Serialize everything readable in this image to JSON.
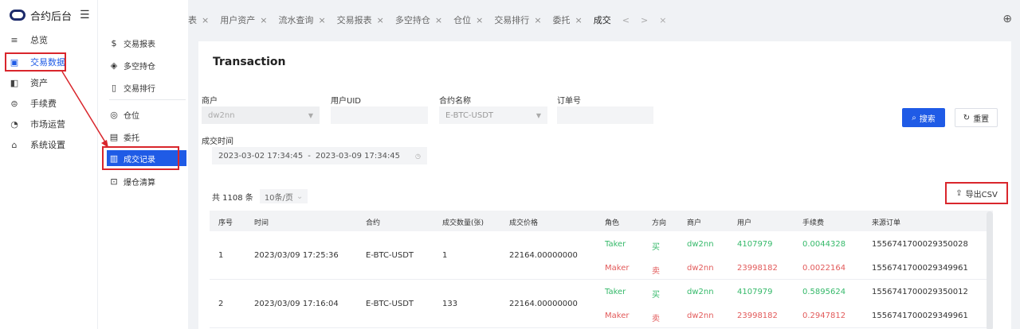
{
  "app": {
    "title": "合约后台"
  },
  "sidebar": {
    "items": [
      {
        "label": "总览",
        "icon": "menu-icon"
      },
      {
        "label": "交易数据",
        "icon": "chart-icon"
      },
      {
        "label": "资产",
        "icon": "wallet-icon"
      },
      {
        "label": "手续费",
        "icon": "fee-icon"
      },
      {
        "label": "市场运营",
        "icon": "operations-icon"
      },
      {
        "label": "系统设置",
        "icon": "settings-icon"
      }
    ]
  },
  "submenu": {
    "items": [
      {
        "label": "交易报表",
        "icon": "dollar-icon"
      },
      {
        "label": "多空持仓",
        "icon": "position-icon"
      },
      {
        "label": "交易排行",
        "icon": "ranking-icon"
      },
      {
        "label": "仓位",
        "icon": "circle-icon"
      },
      {
        "label": "委托",
        "icon": "order-icon"
      },
      {
        "label": "成交记录",
        "icon": "record-icon"
      },
      {
        "label": "爆仓清算",
        "icon": "liquidation-icon"
      }
    ]
  },
  "tabs": [
    {
      "label": "表"
    },
    {
      "label": "用户资产"
    },
    {
      "label": "流水查询"
    },
    {
      "label": "交易报表"
    },
    {
      "label": "多空持仓"
    },
    {
      "label": "仓位"
    },
    {
      "label": "交易排行"
    },
    {
      "label": "委托"
    }
  ],
  "active_tab": "成交",
  "page": {
    "title": "Transaction"
  },
  "filters": {
    "merchant_label": "商户",
    "merchant_value": "dw2nn",
    "uid_label": "用户UID",
    "contract_label": "合约名称",
    "contract_value": "E-BTC-USDT",
    "order_label": "订单号",
    "time_label": "成交时间",
    "time_start": "2023-03-02 17:34:45",
    "time_sep": "-",
    "time_end": "2023-03-09 17:34:45",
    "search_label": "搜索",
    "reset_label": "重置"
  },
  "summary": {
    "total": "共 1108 条",
    "page_size": "10条/页"
  },
  "export_label": "导出CSV",
  "table": {
    "headers": [
      "序号",
      "时间",
      "合约",
      "成交数量(张)",
      "成交价格",
      "角色",
      "方向",
      "商户",
      "用户",
      "手续费",
      "来源订单"
    ],
    "rows": [
      {
        "no": "1",
        "time": "2023/03/09 17:25:36",
        "contract": "E-BTC-USDT",
        "qty": "1",
        "price": "22164.00000000",
        "sub": [
          {
            "role": "Taker",
            "side": "买",
            "merchant": "dw2nn",
            "user": "4107979",
            "fee": "0.0044328",
            "order": "1556741700029350028"
          },
          {
            "role": "Maker",
            "side": "卖",
            "merchant": "dw2nn",
            "user": "23998182",
            "fee": "0.0022164",
            "order": "1556741700029349961"
          }
        ]
      },
      {
        "no": "2",
        "time": "2023/03/09 17:16:04",
        "contract": "E-BTC-USDT",
        "qty": "133",
        "price": "22164.00000000",
        "sub": [
          {
            "role": "Taker",
            "side": "买",
            "merchant": "dw2nn",
            "user": "4107979",
            "fee": "0.5895624",
            "order": "1556741700029350012"
          },
          {
            "role": "Maker",
            "side": "卖",
            "merchant": "dw2nn",
            "user": "23998182",
            "fee": "0.2947812",
            "order": "1556741700029349961"
          }
        ]
      }
    ]
  },
  "colors": {
    "primary": "#1f5be6",
    "annotation": "#d9262c",
    "buy": "#35b96a",
    "sell": "#e25a5a"
  }
}
